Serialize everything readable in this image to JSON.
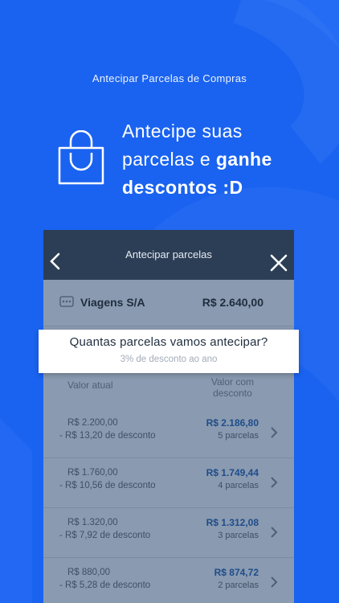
{
  "caption": "Antecipar Parcelas de Compras",
  "headline": {
    "line1": "Antecipe suas",
    "line2_prefix": "parcelas e ",
    "line2_bold": "ganhe",
    "line3": "descontos :D"
  },
  "screen": {
    "title": "Antecipar parcelas",
    "merchant": {
      "icon": "card-icon",
      "name": "Viagens S/A",
      "value": "R$ 2.640,00"
    },
    "question": "Quantas parcelas vamos antecipar?",
    "question_sub": "3% de desconto ao ano",
    "col_current": "Valor atual",
    "col_discount_1": "Valor com",
    "col_discount_2": "desconto",
    "installments": [
      {
        "current": "R$ 2.200,00",
        "discount": "- R$ 13,20 de desconto",
        "value": "R$ 2.186,80",
        "count": "5 parcelas"
      },
      {
        "current": "R$ 1.760,00",
        "discount": "- R$ 10,56 de desconto",
        "value": "R$ 1.749,44",
        "count": "4 parcelas"
      },
      {
        "current": "R$ 1.320,00",
        "discount": "- R$ 7,92 de desconto",
        "value": "R$ 1.312,08",
        "count": "3 parcelas"
      },
      {
        "current": "R$ 880,00",
        "discount": "- R$ 5,28 de desconto",
        "value": "R$ 874,72",
        "count": "2 parcelas"
      }
    ]
  },
  "colors": {
    "background": "#1a63f0",
    "header": "#2c3e55",
    "accent": "#1e4d8a"
  }
}
